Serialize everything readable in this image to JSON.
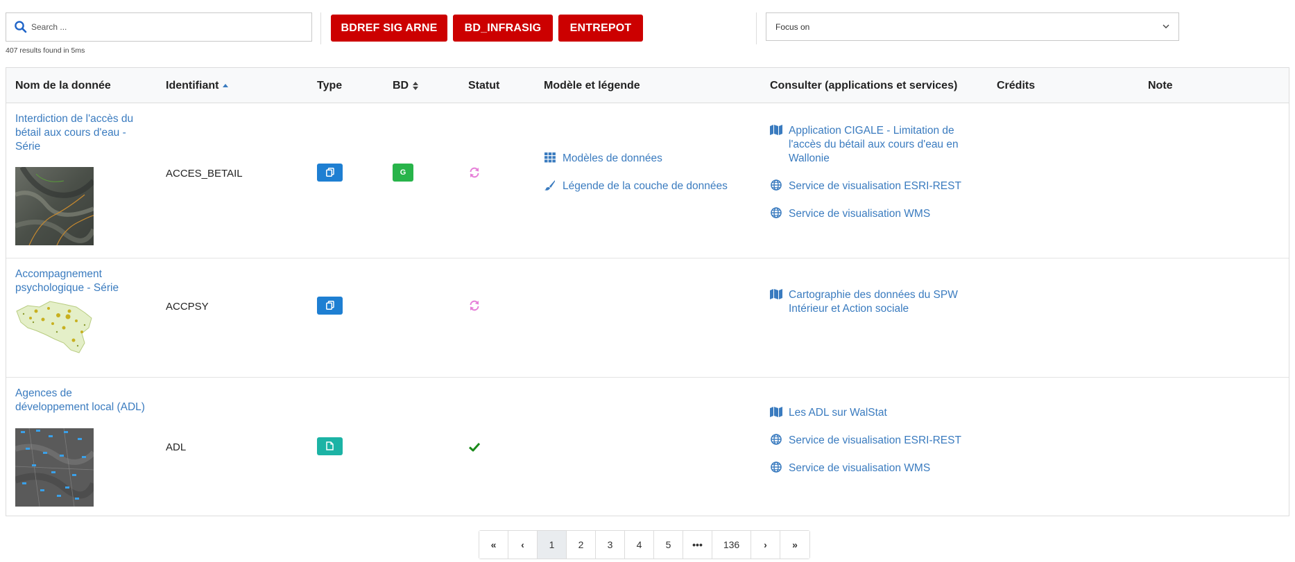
{
  "search": {
    "placeholder": "Search ...",
    "results": "407 results found in 5ms"
  },
  "db_buttons": [
    "BDREF SIG ARNE",
    "BD_INFRASIG",
    "ENTREPOT"
  ],
  "focus": {
    "value": "Focus on"
  },
  "columns": {
    "name": "Nom de la donnée",
    "ident": "Identifiant",
    "type": "Type",
    "bd": "BD",
    "status": "Statut",
    "model": "Modèle et légende",
    "consult": "Consulter (applications et services)",
    "credits": "Crédits",
    "note": "Note"
  },
  "rows": [
    {
      "name": "Interdiction de l'accès du bétail aux cours d'eau - Série",
      "ident": "ACCES_BETAIL",
      "type_icon": "copy-icon",
      "type_color": "#1e7fd2",
      "bd_label": "G",
      "bd_color": "#28b44a",
      "status_icon": "refresh-icon",
      "model_links": [
        "Modèles de données",
        "Légende de la couche de données"
      ],
      "consult_links": [
        "Application CIGALE - Limitation de l'accès du bétail aux cours d'eau en Wallonie",
        "Service de visualisation ESRI-REST",
        "Service de visualisation WMS"
      ]
    },
    {
      "name": "Accompagnement psychologique - Série",
      "ident": "ACCPSY",
      "type_icon": "copy-icon",
      "type_color": "#1e7fd2",
      "status_icon": "refresh-icon",
      "consult_links": [
        "Cartographie des données du SPW Intérieur et Action sociale"
      ]
    },
    {
      "name": "Agences de développement local (ADL)",
      "ident": "ADL",
      "type_icon": "file-icon",
      "type_color": "#1cb3a5",
      "status_icon": "check-icon",
      "consult_links": [
        "Les ADL sur WalStat",
        "Service de visualisation ESRI-REST",
        "Service de visualisation WMS"
      ]
    }
  ],
  "colors": {
    "accent": "#cc0000",
    "link": "#3a7bbf",
    "status_refresh": "#e67fd8",
    "status_ok": "#1a8a1a"
  },
  "pagination": {
    "pages": [
      "1",
      "2",
      "3",
      "4",
      "5",
      "•••",
      "136"
    ],
    "active": "1",
    "first": "«",
    "prev": "‹",
    "next": "›",
    "last": "»"
  }
}
